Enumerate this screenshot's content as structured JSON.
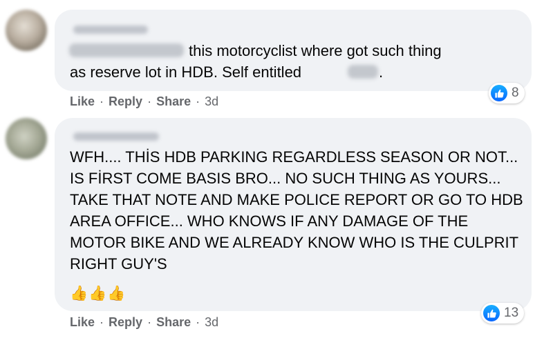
{
  "comments": [
    {
      "text_line1": "this motorcyclist where got such thing",
      "text_line2": "as reserve lot in HDB. Self entitled",
      "text_end": ".",
      "reaction_count": "8",
      "actions": {
        "like": "Like",
        "reply": "Reply",
        "share": "Share",
        "sep": "·",
        "time": "3d"
      }
    },
    {
      "text": "WFH.... THİS HDB PARKING REGARDLESS SEASON OR NOT... IS FİRST COME BASIS BRO... NO SUCH THING AS YOURS... TAKE THAT NOTE AND MAKE POLICE REPORT OR GO TO HDB AREA OFFICE... WHO KNOWS IF ANY DAMAGE OF THE MOTOR BIKE AND WE ALREADY KNOW WHO IS THE CULPRIT RIGHT GUY'S",
      "emojis": "👍👍👍",
      "reaction_count": "13",
      "actions": {
        "like": "Like",
        "reply": "Reply",
        "share": "Share",
        "sep": "·",
        "time": "3d"
      }
    }
  ],
  "colors": {
    "bubble": "#f0f2f5",
    "meta": "#65676b",
    "like_blue": "#0866ff"
  },
  "icons": [
    "avatar",
    "like-reaction-icon",
    "thumbs-up-emoji"
  ]
}
